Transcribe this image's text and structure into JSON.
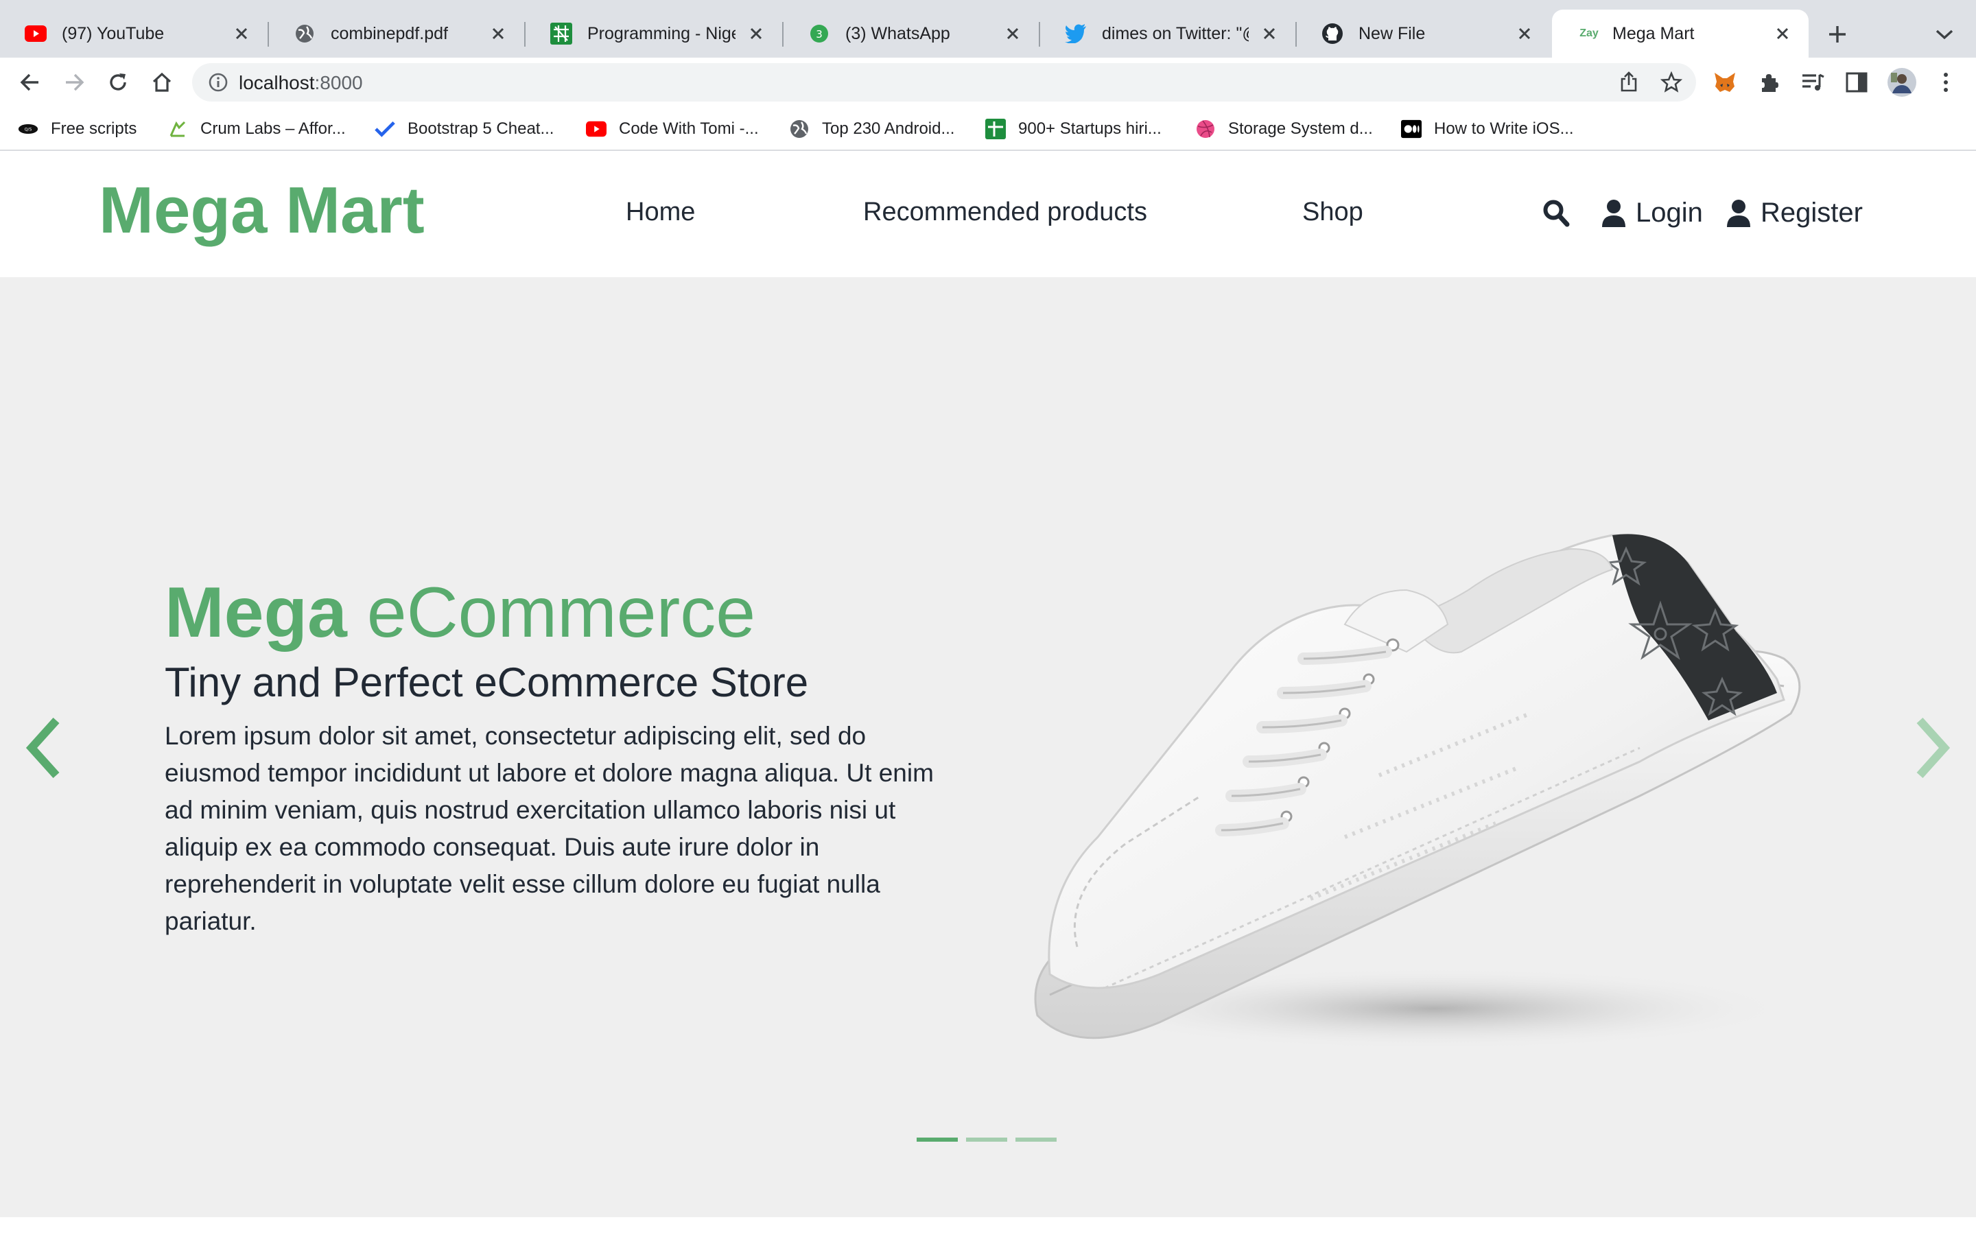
{
  "browser": {
    "tabs": [
      {
        "title": "(97) YouTube",
        "icon": "youtube-icon"
      },
      {
        "title": "combinepdf.pdf",
        "icon": "globe-icon"
      },
      {
        "title": "Programming - Nigeri",
        "icon": "sheet-icon"
      },
      {
        "title": "(3) WhatsApp",
        "icon": "whatsapp-icon"
      },
      {
        "title": "dimes on Twitter: \"@a",
        "icon": "twitter-icon"
      },
      {
        "title": "New File",
        "icon": "github-icon"
      },
      {
        "title": "Mega Mart",
        "icon": "zay-icon",
        "fav_text": "Zay"
      }
    ],
    "address": {
      "host": "localhost",
      "port": ":8000"
    },
    "bookmarks": [
      {
        "label": "Free scripts",
        "icon": "scripts-icon"
      },
      {
        "label": "Crum Labs – Affor...",
        "icon": "crum-icon"
      },
      {
        "label": "Bootstrap 5 Cheat...",
        "icon": "check-icon"
      },
      {
        "label": "Code With Tomi -...",
        "icon": "youtube-icon"
      },
      {
        "label": "Top 230 Android...",
        "icon": "globe-icon"
      },
      {
        "label": "900+ Startups hiri...",
        "icon": "sheet-icon"
      },
      {
        "label": "Storage System d...",
        "icon": "dribbble-icon"
      },
      {
        "label": "How to Write iOS...",
        "icon": "medium-icon"
      }
    ]
  },
  "site": {
    "logo": "Mega Mart",
    "nav": {
      "home": "Home",
      "recommended": "Recommended products",
      "shop": "Shop"
    },
    "login": "Login",
    "register": "Register"
  },
  "hero": {
    "title_bold": "Mega",
    "title_light": " eCommerce",
    "subtitle": "Tiny and Perfect eCommerce Store",
    "body": "Lorem ipsum dolor sit amet, consectetur adipiscing elit, sed do eiusmod tempor incididunt ut labore et dolore magna aliqua. Ut enim ad minim veniam, quis nostrud exercitation ullamco laboris nisi ut aliquip ex ea commodo consequat. Duis aute irure dolor in reprehenderit in voluptate velit esse cillum dolore eu fugiat nulla pariatur.",
    "slide_count": 3,
    "active_slide": 1
  },
  "colors": {
    "brand": "#59ab6e",
    "text": "#212934",
    "hero_bg": "#efefef"
  }
}
